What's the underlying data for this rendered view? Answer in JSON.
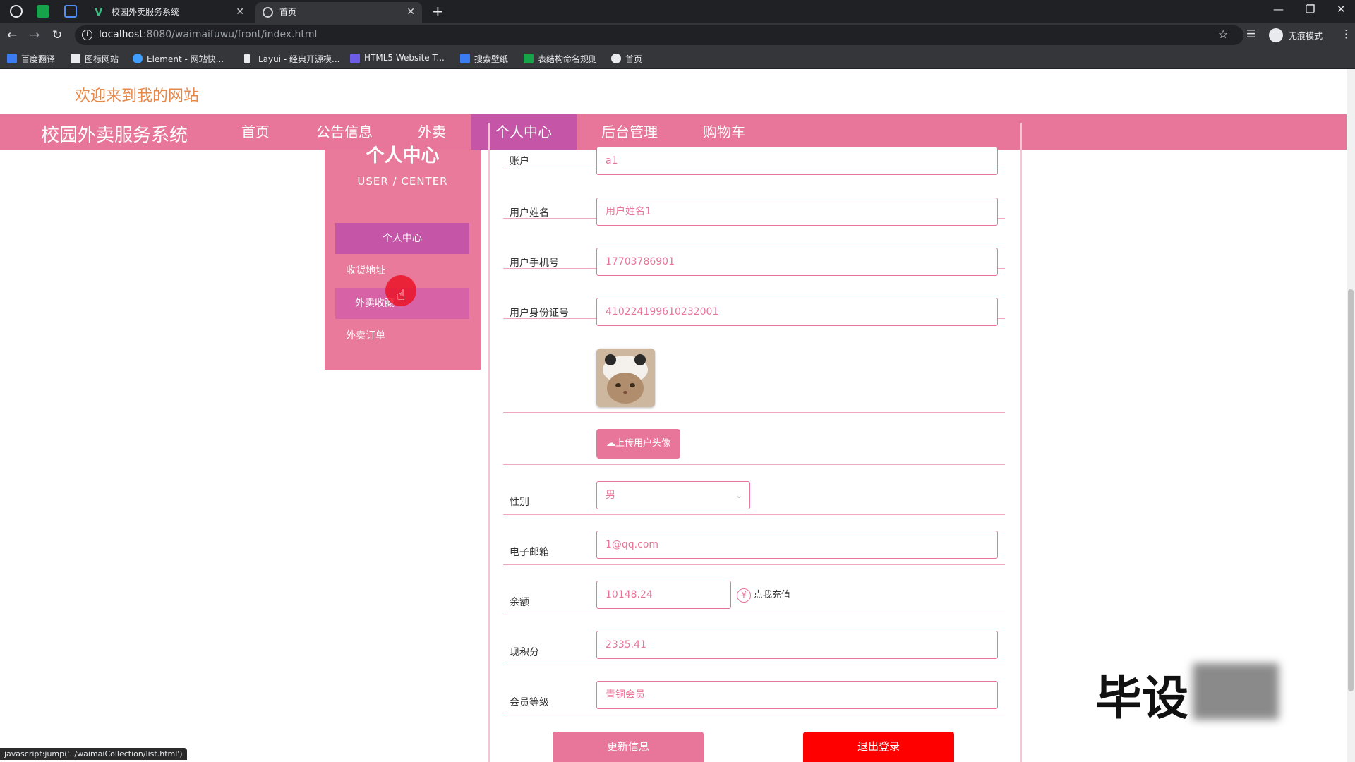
{
  "browser": {
    "tabs": [
      {
        "title": "校园外卖服务系统"
      },
      {
        "title": "首页"
      }
    ],
    "url_host": "localhost",
    "url_rest": ":8080/waimaifuwu/front/index.html",
    "incognito_label": "无痕模式",
    "bookmarks": [
      {
        "label": "百度翻译",
        "color": "#3b7cf4"
      },
      {
        "label": "图标网站",
        "color": "#e8eaed"
      },
      {
        "label": "Element - 网站快...",
        "color": "#409eff"
      },
      {
        "label": "Layui - 经典开源模...",
        "color": "#e8eaed"
      },
      {
        "label": "HTML5 Website T...",
        "color": "#6c5ce7"
      },
      {
        "label": "搜索壁纸",
        "color": "#3b7cf4"
      },
      {
        "label": "表结构命名规则",
        "color": "#16a34a"
      },
      {
        "label": "首页",
        "color": "#e8eaed"
      }
    ],
    "status_text": "javascript:jump('../waimaiCollection/list.html')"
  },
  "site": {
    "welcome": "欢迎来到我的网站",
    "brand": "校园外卖服务系统",
    "nav": [
      "首页",
      "公告信息",
      "外卖",
      "个人中心",
      "后台管理",
      "购物车"
    ],
    "nav_active": "个人中心"
  },
  "sidebar": {
    "title": "个人中心",
    "subtitle": "USER / CENTER",
    "items": [
      "个人中心",
      "收货地址",
      "外卖收藏",
      "外卖订单"
    ]
  },
  "form": {
    "account_label": "账户",
    "account_value": "a1",
    "name_label": "用户姓名",
    "name_value": "用户姓名1",
    "phone_label": "用户手机号",
    "phone_value": "17703786901",
    "idcard_label": "用户身份证号",
    "idcard_value": "410224199610232001",
    "upload_label": "上传用户头像",
    "gender_label": "性别",
    "gender_value": "男",
    "email_label": "电子邮箱",
    "email_value": "1@qq.com",
    "balance_label": "余额",
    "balance_value": "10148.24",
    "recharge_label": "点我充值",
    "points_label": "现积分",
    "points_value": "2335.41",
    "level_label": "会员等级",
    "level_value": "青铜会员",
    "update_label": "更新信息",
    "logout_label": "退出登录"
  },
  "watermark": "毕设",
  "colors": {
    "accent": "#e8769a",
    "active": "#c555a7",
    "danger": "#ff0000",
    "welcome": "#e6884a"
  }
}
